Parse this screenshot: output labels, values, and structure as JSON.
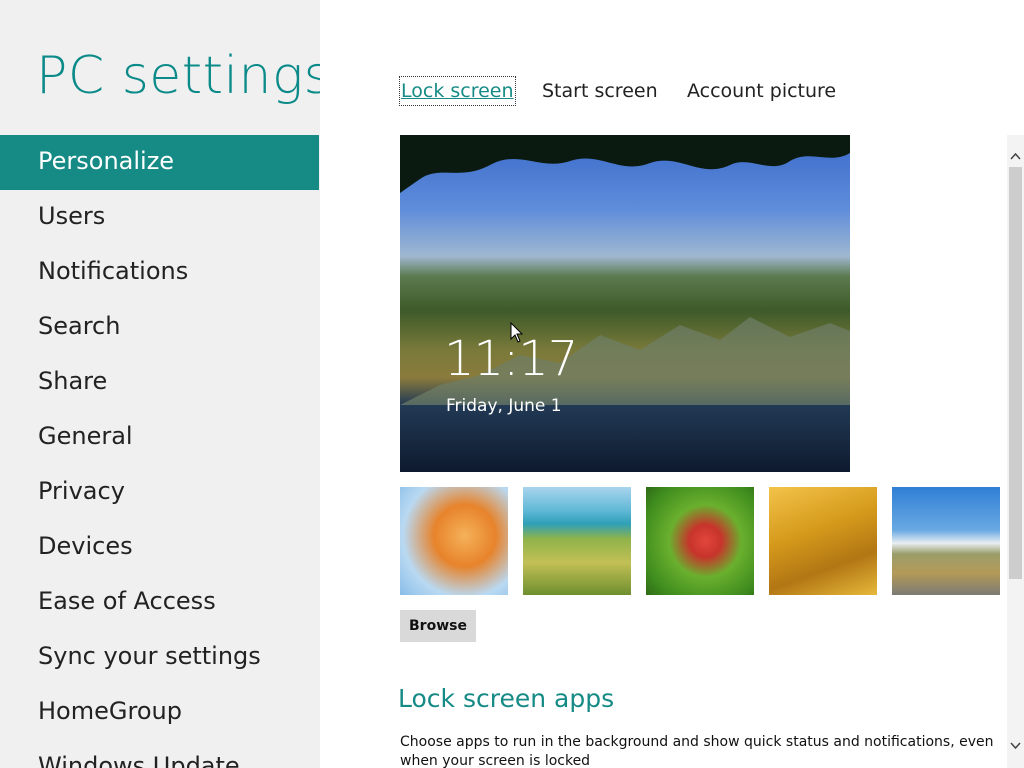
{
  "app": {
    "title": "PC settings"
  },
  "sidebar": {
    "items": [
      {
        "label": "Personalize",
        "selected": true
      },
      {
        "label": "Users"
      },
      {
        "label": "Notifications"
      },
      {
        "label": "Search"
      },
      {
        "label": "Share"
      },
      {
        "label": "General"
      },
      {
        "label": "Privacy"
      },
      {
        "label": "Devices"
      },
      {
        "label": "Ease of Access"
      },
      {
        "label": "Sync your settings"
      },
      {
        "label": "HomeGroup"
      },
      {
        "label": "Windows Update"
      }
    ]
  },
  "tabs": [
    {
      "label": "Lock screen",
      "active": true
    },
    {
      "label": "Start screen"
    },
    {
      "label": "Account picture"
    }
  ],
  "preview": {
    "time": "11:17",
    "date": "Friday, June 1"
  },
  "thumbnails": [
    {
      "name": "orange-leaves"
    },
    {
      "name": "coastal-hills"
    },
    {
      "name": "red-flowers"
    },
    {
      "name": "golden-grass"
    },
    {
      "name": "mountain-road"
    }
  ],
  "browse_label": "Browse",
  "lock_screen_apps": {
    "title": "Lock screen apps",
    "description": "Choose apps to run in the background and show quick status and notifications, even when your screen is locked"
  },
  "colors": {
    "accent": "#168b86",
    "title": "#0a8a88",
    "left_bg": "#f0f0f0"
  },
  "icons": {
    "scroll_up": "scroll-up-icon",
    "scroll_down": "scroll-down-icon",
    "cursor": "mouse-cursor-icon"
  }
}
